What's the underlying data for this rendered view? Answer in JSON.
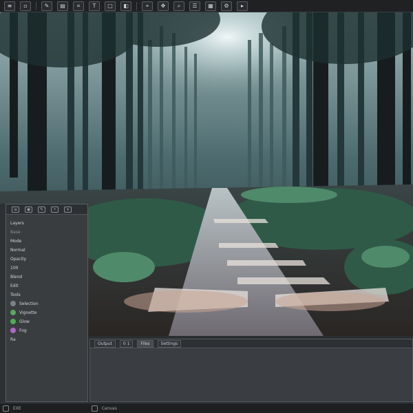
{
  "toolbar": {
    "icons": [
      "menu-icon",
      "file-icon",
      "brush-icon",
      "layers-icon",
      "crop-icon",
      "text-icon",
      "shape-icon",
      "eraser-icon",
      "picker-icon",
      "move-icon",
      "zoom-icon",
      "hand-icon",
      "grid-icon",
      "settings-icon",
      "play-icon"
    ]
  },
  "left_panel": {
    "title": "",
    "items": [
      {
        "label": "Layers",
        "style": "normal"
      },
      {
        "label": "Base",
        "style": "dim"
      },
      {
        "label": "Mode",
        "style": "normal"
      },
      {
        "label": "Normal",
        "style": "normal"
      },
      {
        "label": "Opacity",
        "style": "normal"
      },
      {
        "label": "100",
        "style": "normal"
      },
      {
        "label": "Blend",
        "style": "normal"
      },
      {
        "label": "Edit",
        "style": "normal"
      },
      {
        "label": "Tools",
        "style": "normal"
      },
      {
        "label": "Selection",
        "style": "normal",
        "dot": "#7a8288"
      },
      {
        "label": "Vignette",
        "style": "normal",
        "dot": "#5aa85f"
      },
      {
        "label": "Glow",
        "style": "normal",
        "dot": "#4caf50"
      },
      {
        "label": "Fog",
        "style": "normal",
        "dot": "#b067c7"
      },
      {
        "label": "Ra",
        "style": "normal"
      }
    ]
  },
  "bottom_panel": {
    "tabs": [
      "Output",
      "0 1",
      "Files",
      "Settings"
    ]
  },
  "statusbar": {
    "left_label": "EXE",
    "right_label": "Canvas"
  },
  "colors": {
    "ui_bg": "#2b2d2f",
    "panel_bg": "#3a3d40",
    "toolbar_bg": "#1f2123"
  }
}
